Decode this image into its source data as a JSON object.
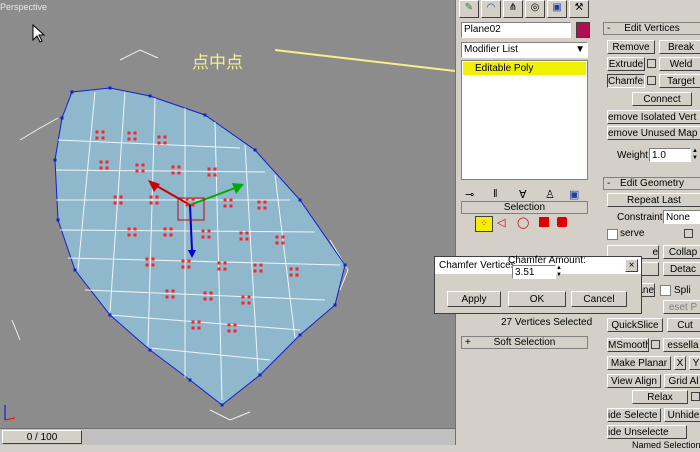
{
  "viewport": {
    "label": "Perspective"
  },
  "annotation": {
    "text": "点中点"
  },
  "timeline": {
    "frame": "0 / 100"
  },
  "modify_panel": {
    "tabs": [
      "create-tab-icon",
      "modify-tab-icon",
      "hierarchy-tab-icon",
      "motion-tab-icon",
      "display-tab-icon",
      "utilities-tab-icon"
    ],
    "object_name": "Plane02",
    "object_color": "#b01050",
    "modifier_list_label": "Modifier List",
    "stack_item": "Editable Poly",
    "selection_title": "Selection",
    "vertices_selected": "27 Vertices Selected",
    "soft_selection_title": "Soft Selection"
  },
  "edit_vertices": {
    "title": "Edit Vertices",
    "remove": "Remove",
    "break": "Break",
    "extrude": "Extrude",
    "weld": "Weld",
    "chamfer": "Chamfer",
    "target_weld": "Target",
    "connect": "Connect",
    "remove_isolated": "emove Isolated Vert",
    "remove_unused": "emove Unused Map V",
    "weight_label": "Weight:",
    "weight_value": "1.0"
  },
  "edit_geometry": {
    "title": "Edit Geometry",
    "repeat_last": "Repeat Last",
    "constraints_label": "Constraints:",
    "constraints_value": "None",
    "preserve": "serve",
    "create": "e",
    "collapse": "Collap",
    "attach": "",
    "detach": "Detac",
    "slice_plane": "lane",
    "split": "Spli",
    "reset_plane": "eset P",
    "quickslice": "QuickSlice",
    "cut": "Cut",
    "msmooth": "MSmooth",
    "tessellate": "essella",
    "make_planar": "Make Planar",
    "x": "X",
    "y": "Y",
    "view_align": "View Align",
    "grid_align": "Grid Al",
    "relax": "Relax",
    "hide_selected": "ide Selecte",
    "unhide": "Unhide",
    "hide_unselected": "ide Unselecte",
    "named_selections": "Named Selections"
  },
  "chamfer_dialog": {
    "title": "Chamfer Vertices",
    "amount_label": "Chamfer Amount:",
    "amount_value": "3.51",
    "apply": "Apply",
    "ok": "OK",
    "cancel": "Cancel"
  },
  "colors": {
    "viewport_bg": "#8c8c8c",
    "mesh": "#8fb8cc",
    "vertex_sel": "#ff2020",
    "arrow": "#f5f08a",
    "stack_highlight": "#f0f000"
  }
}
